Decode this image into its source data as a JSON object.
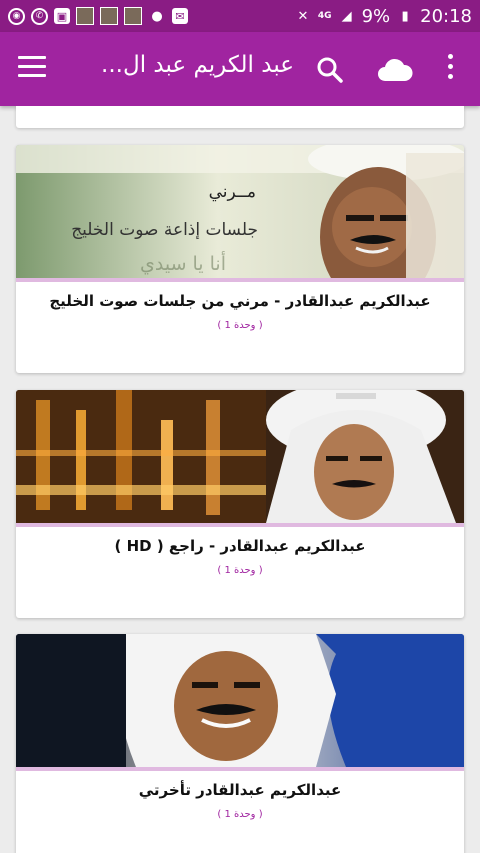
{
  "status_bar": {
    "battery": "9%",
    "time": "20:18",
    "network": "4G"
  },
  "app_bar": {
    "title": "عبد الكريم عبد ال...",
    "icons": [
      "menu-icon",
      "search-icon",
      "cloud-icon",
      "more-vert-icon"
    ]
  },
  "items": [
    {
      "title": "عبدالكريم عبدالقادر - مرني من جلسات صوت الخليج",
      "count": "( 1 وحدة )",
      "image_text_1": "مــرني",
      "image_text_2": "جلسات إذاعة صوت الخليج",
      "image_text_3": "أنا يا سيدي"
    },
    {
      "title": "عبدالكريم عبدالقادر - راجع ( HD )",
      "count": "( 1 وحدة )"
    },
    {
      "title": "عبدالكريم عبدالقادر تأخرتي",
      "count": "( 1 وحدة )"
    }
  ],
  "colors": {
    "status_bar": "#8a1c84",
    "app_bar": "#a024a0",
    "accent_line": "#e0b9e0",
    "background": "#ececec"
  }
}
